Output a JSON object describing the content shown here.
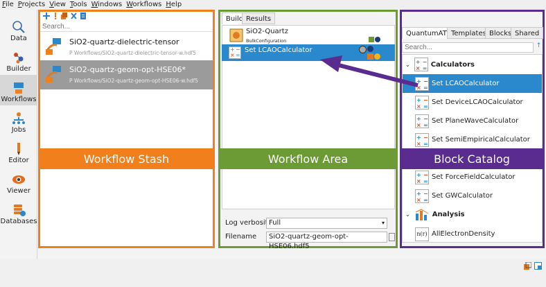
{
  "menu": [
    {
      "u": "F",
      "rest": "ile"
    },
    {
      "u": "P",
      "rest": "rojects"
    },
    {
      "u": "V",
      "rest": "iew"
    },
    {
      "u": "T",
      "rest": "ools"
    },
    {
      "u": "W",
      "rest": "indows"
    },
    {
      "u": "W",
      "rest": "orkflows"
    },
    {
      "u": "H",
      "rest": "elp"
    }
  ],
  "sidebar": {
    "items": [
      {
        "label": "Data",
        "icon": "magnifier-icon"
      },
      {
        "label": "Builder",
        "icon": "builder-icon"
      },
      {
        "label": "Workflows",
        "icon": "workflows-icon"
      },
      {
        "label": "Jobs",
        "icon": "jobs-icon"
      },
      {
        "label": "Editor",
        "icon": "editor-icon"
      },
      {
        "label": "Viewer",
        "icon": "eye-icon"
      },
      {
        "label": "Databases",
        "icon": "database-icon"
      }
    ],
    "active": "Workflows"
  },
  "stash": {
    "search_placeholder": "Search...",
    "toolbar_icons": [
      "add-icon",
      "warning-icon",
      "copy-icon",
      "delete-icon",
      "file-icon"
    ],
    "items": [
      {
        "title": "SiO2-quartz-dielectric-tensor",
        "path": "P Workflows/SiO2-quartz-dielectric-tensor-w.hdf5"
      },
      {
        "title": "SiO2-quartz-geom-opt-HSE06*",
        "path": "P Workflows/SiO2-quartz-geom-opt-HSE06-w.hdf5"
      }
    ],
    "overlay_label": "Workflow Stash",
    "accent": "#f07f1c"
  },
  "center": {
    "tabs": [
      "Build",
      "Results"
    ],
    "blocks": [
      {
        "title": "SiO2-Quartz",
        "subtitle": "BulkConfiguration"
      },
      {
        "title": "Set LCAOCalculator"
      }
    ],
    "log_verbosity_label": "Log verbosity",
    "log_verbosity_value": "Full",
    "filename_label": "Filename",
    "filename_value": "SiO2-quartz-geom-opt-HSE06.hdf5",
    "overlay_label": "Workflow  Area",
    "accent": "#6c9a34"
  },
  "right": {
    "tabs": [
      "QuantumATK",
      "Templates",
      "Blocks",
      "Shared"
    ],
    "search_placeholder": "Search...",
    "categories": [
      {
        "label": "Calculators"
      },
      {
        "label": "Analysis"
      }
    ],
    "calculators": [
      "Set LCAOCalculator",
      "Set DeviceLCAOCalculator",
      "Set PlaneWaveCalculator",
      "Set SemiEmpiricalCalculator",
      "Set ForceFieldCalculator",
      "Set GWCalculator"
    ],
    "analysis": [
      "AllElectronDensity"
    ],
    "analysis_icon_text": "n(r)",
    "overlay_label": "Block Catalog",
    "accent": "#5b2c8f"
  },
  "colors": {
    "selection": "#2a88cc",
    "arrow": "#5b2c8f"
  }
}
